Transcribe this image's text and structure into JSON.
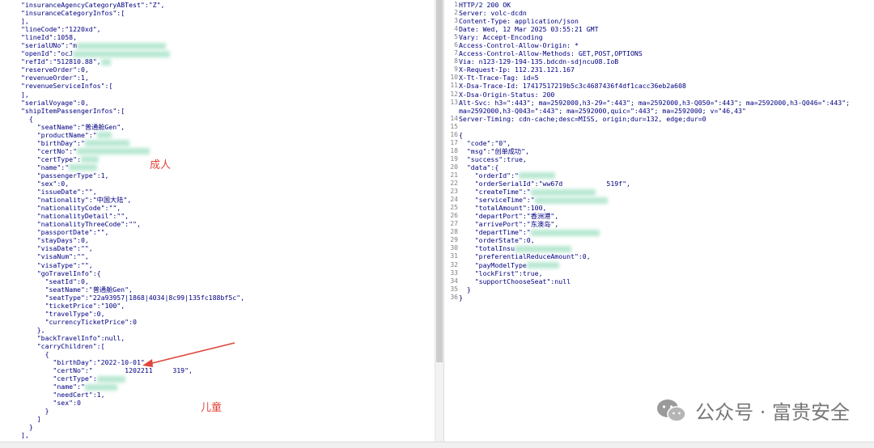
{
  "request_lines": [
    "\"insuranceAgencyCategoryABTest\":\"Z\",",
    "\"insuranceCategoryInfos\":[",
    "],",
    "\"lineCode\":\"1220xd\",",
    "\"lineId\":1058,",
    "\"serialUNo\":\"m",
    "\"openId\":\"ocJ",
    "\"refId\":\"512810.88\",",
    "\"reserveOrder\":0,",
    "\"revenueOrder\":1,",
    "\"revenueServiceInfos\":[",
    "],",
    "\"serialVoyage\":0,",
    "\"shipItemPassengerInfos\":[",
    "  {",
    "    \"seatName\":\"普通舱Gen\",",
    "    \"productName\":\"",
    "    \"birthDay\":\"",
    "    \"certNo\":\"",
    "    \"certType\":",
    "    \"name\":\"",
    "    \"passengerType\":1,",
    "    \"sex\":0,",
    "    \"issueDate\":\"\",",
    "    \"nationality\":\"中国大陆\",",
    "    \"nationalityCode\":\"\",",
    "    \"nationalityDetail\":\"\",",
    "    \"nationalityThreeCode\":\"\",",
    "    \"passportDate\":\"\",",
    "    \"stayDays\":0,",
    "    \"visaDate\":\"\",",
    "    \"visaNum\":\"\",",
    "    \"visaType\":\"\",",
    "    \"goTravelInfo\":{",
    "      \"seatId\":0,",
    "      \"seatName\":\"普通舱Gen\",",
    "      \"seatType\":\"22a93957|1868|4034|8c99|135fc188bf5c\",",
    "      \"ticketPrice\":\"100\",",
    "      \"travelType\":0,",
    "      \"currencyTicketPrice\":0",
    "    },",
    "    \"backTravelInfo\":null,",
    "    \"carryChildren\":[",
    "      {",
    "        \"birthDay\":\"2022-10-01\",",
    "        \"certNo\":\"        1202211     319\",",
    "        \"certType\":",
    "        \"name\":\"",
    "        \"needCert\":1,",
    "        \"sex\":0",
    "      }",
    "    ]",
    "  }",
    "],"
  ],
  "response_lines": [
    "HTTP/2 200 OK",
    "Server: volc-dcdn",
    "Content-Type: application/json",
    "Date: Wed, 12 Mar 2025 03:55:21 GMT",
    "Vary: Accept-Encoding",
    "Access-Control-Allow-Origin: *",
    "Access-Control-Allow-Methods: GET,POST,OPTIONS",
    "Via: n123-129-194-135.bdcdn-sdjncu08.IoB",
    "X-Request-Ip: 112.231.121.167",
    "X-Tt-Trace-Tag: id=5",
    "X-Dsa-Trace-Id: 17417517219b5c3c4687436f4df1cacc36eb2a608",
    "X-Dsa-Origin-Status: 200",
    "Alt-Svc: h3=\":443\"; ma=2592000,h3-29=\":443\"; ma=2592000,h3-Q050=\":443\"; ma=2592000,h3-Q046=\":443\";",
    "ma=2592000,h3-Q043=\":443\"; ma=2592000,quic=\":443\"; ma=2592000; v=\"46,43\"",
    "Server-Timing: cdn-cache;desc=MISS, origin;dur=132, edge;dur=0",
    "",
    "{",
    "  \"code\":\"0\",",
    "  \"msg\":\"创单成功\",",
    "  \"success\":true,",
    "  \"data\":{",
    "    \"orderId\":\"",
    "    \"orderSerialId\":\"ww67d           519f\",",
    "    \"createTime\":\"",
    "    \"serviceTime\":\"",
    "    \"totalAmount\":100,",
    "    \"departPort\":\"香洲港\",",
    "    \"arrivePort\":\"东澳岛\",",
    "    \"departTime\":\"",
    "    \"orderState\":0,",
    "    \"totalInsu",
    "    \"preferentialReduceAmount\":0,",
    "    \"payModelType",
    "    \"lockFirst\":true,",
    "    \"supportChooseSeat\":null",
    "  }",
    "}"
  ],
  "response_line_numbers": [
    "1",
    "2",
    "3",
    "4",
    "5",
    "6",
    "7",
    "8",
    "9",
    "10",
    "11",
    "12",
    "13",
    "",
    "14",
    "15",
    "16",
    "17",
    "18",
    "19",
    "20",
    "21",
    "22",
    "23",
    "24",
    "25",
    "26",
    "27",
    "28",
    "29",
    "30",
    "31",
    "32",
    "33",
    "34",
    "35",
    "36"
  ],
  "annotations": {
    "adult_label": "成人",
    "child_label": "儿童"
  },
  "watermark": {
    "text": "公众号 · 富贵安全",
    "icon": "wechat-icon"
  },
  "colors": {
    "annotation": "#e0453a",
    "key_text": "#000080",
    "redaction_blur": "#b8e8d2"
  }
}
